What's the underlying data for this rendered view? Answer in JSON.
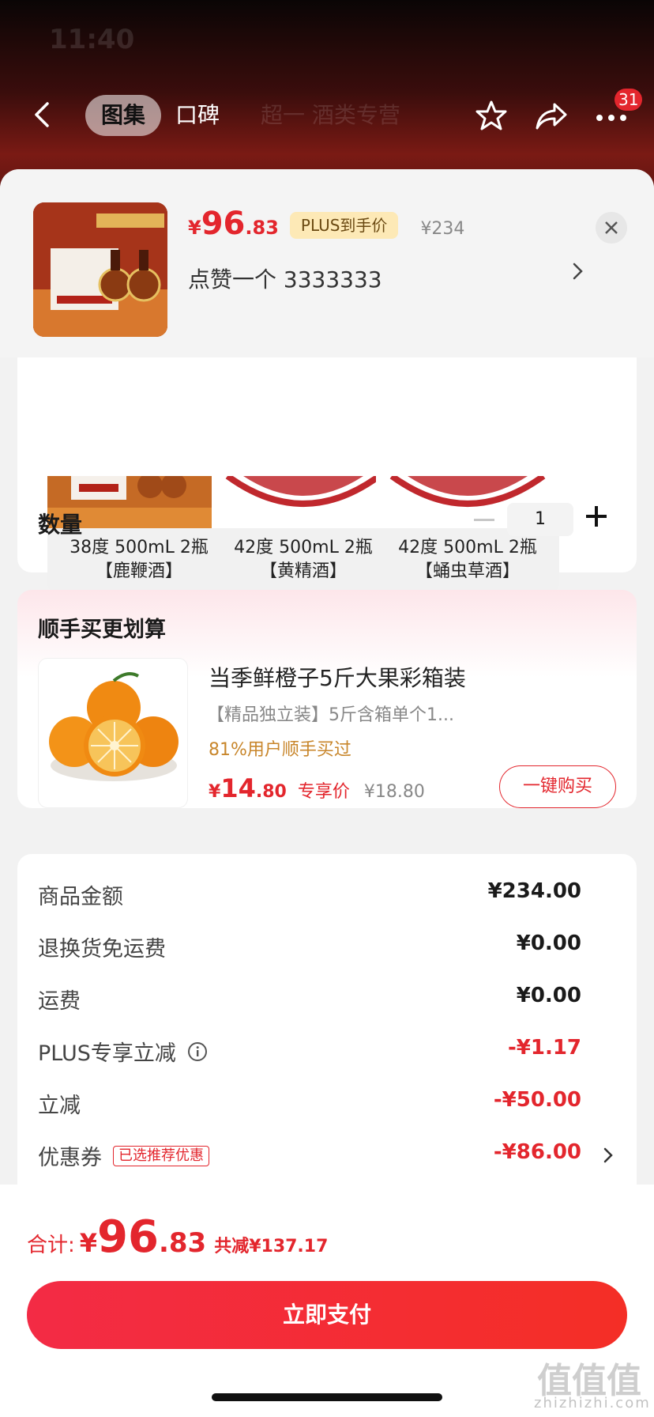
{
  "status": {
    "time": "11:40"
  },
  "nav": {
    "tab_gallery": "图集",
    "tab_reviews": "口碑",
    "ghost_text": "超一 酒类专营",
    "badge_count": "31"
  },
  "product": {
    "price_currency": "¥",
    "price_int": "96",
    "price_dec": ".83",
    "plus_tag": "PLUS到手价",
    "original_price": "¥234",
    "liked_text": "点赞一个  3333333"
  },
  "variants": [
    {
      "line1": "38度 500mL 2瓶",
      "line2": "【鹿鞭酒】"
    },
    {
      "line1": "42度 500mL 2瓶",
      "line2": "【黄精酒】"
    },
    {
      "line1": "42度 500mL 2瓶",
      "line2": "【蛹虫草酒】"
    }
  ],
  "quantity": {
    "label": "数量",
    "value": "1"
  },
  "bundle": {
    "title": "顺手买更划算",
    "name": "当季鲜橙子5斤大果彩箱装",
    "desc": "【精品独立装】5斤含箱单个1...",
    "pct": "81%用户顺手买过",
    "price_currency": "¥",
    "price_int": "14",
    "price_dec": ".80",
    "exclusive": "专享价",
    "original": "¥18.80",
    "buy_label": "一键购买"
  },
  "summary": {
    "rows": [
      {
        "label": "商品金额",
        "value": "¥234.00"
      },
      {
        "label": "退换货免运费",
        "value": "¥0.00"
      },
      {
        "label": "运费",
        "value": "¥0.00"
      },
      {
        "label": "PLUS专享立减",
        "value": "-¥1.17"
      },
      {
        "label": "立减",
        "value": "-¥50.00"
      },
      {
        "label": "优惠券",
        "value": "-¥86.00",
        "tag": "已选推荐优惠"
      }
    ]
  },
  "footer": {
    "total_label": "合计:",
    "total_currency": "¥",
    "total_int": "96",
    "total_dec": ".83",
    "saved": "共减¥137.17",
    "pay_label": "立即支付",
    "watermark": "值值值",
    "watermark_url": "zhizhizhi.com"
  },
  "colors": {
    "accent": "#e3262d",
    "plus_tag_bg": "#fde9b6"
  }
}
